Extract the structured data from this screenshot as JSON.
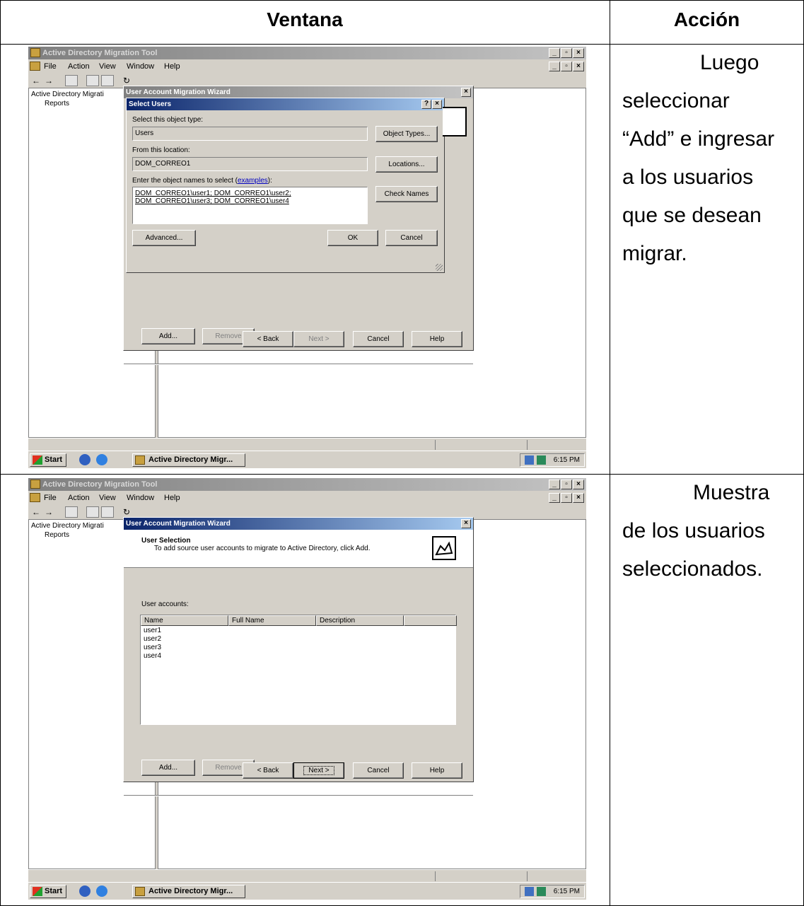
{
  "table": {
    "header_left": "Ventana",
    "header_right": "Acción"
  },
  "rows": [
    {
      "action": [
        "Luego",
        "seleccionar",
        "“Add” e ingresar",
        "a los usuarios",
        "que se desean",
        "migrar."
      ]
    },
    {
      "action": [
        "Muestra",
        "de los usuarios",
        "seleccionados."
      ]
    }
  ],
  "app": {
    "title": "Active Directory Migration Tool",
    "menu": [
      "File",
      "Action",
      "View",
      "Window",
      "Help"
    ],
    "tree_root": "Active Directory Migrati",
    "tree_child": "Reports",
    "start": "Start",
    "task_item": "Active Directory Migr...",
    "clock": "6:15 PM"
  },
  "wizard": {
    "title": "User Account Migration Wizard",
    "header_title": "User Selection",
    "header_sub": "To add source user accounts to migrate to Active Directory, click Add.",
    "accounts_label": "User accounts:",
    "columns": [
      "Name",
      "Full Name",
      "Description"
    ],
    "users": [
      "user1",
      "user2",
      "user3",
      "user4"
    ],
    "add": "Add...",
    "remove": "Remove",
    "back": "< Back",
    "next": "Next >",
    "cancel": "Cancel",
    "help": "Help"
  },
  "select_users": {
    "title": "Select Users",
    "object_type_label": "Select this object type:",
    "object_type_value": "Users",
    "object_types_btn": "Object Types...",
    "location_label": "From this location:",
    "location_value": "DOM_CORREO1",
    "locations_btn": "Locations...",
    "names_label": "Enter the object names to select (",
    "names_link": "examples",
    "names_label_end": "):",
    "names_line1": "DOM_CORREO1\\user1; DOM_CORREO1\\user2;",
    "names_line2": "DOM_CORREO1\\user3; DOM_CORREO1\\user4",
    "check_names_btn": "Check Names",
    "advanced_btn": "Advanced...",
    "ok_btn": "OK",
    "cancel_btn": "Cancel"
  }
}
